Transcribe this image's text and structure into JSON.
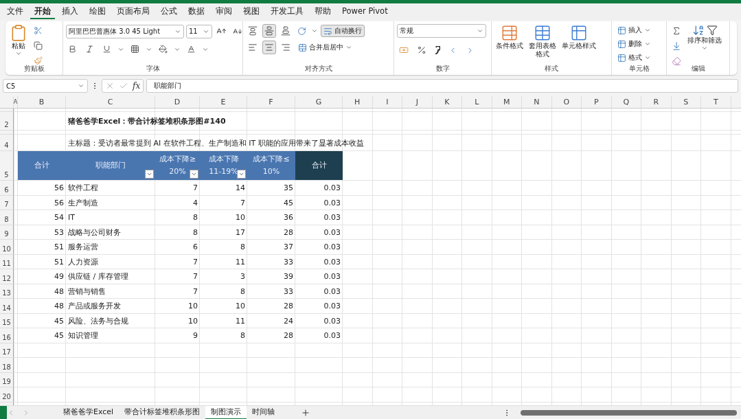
{
  "menu_tabs": [
    {
      "label": "文件",
      "selected": false
    },
    {
      "label": "开始",
      "selected": true
    },
    {
      "label": "插入",
      "selected": false
    },
    {
      "label": "绘图",
      "selected": false
    },
    {
      "label": "页面布局",
      "selected": false
    },
    {
      "label": "公式",
      "selected": false
    },
    {
      "label": "数据",
      "selected": false
    },
    {
      "label": "审阅",
      "selected": false
    },
    {
      "label": "视图",
      "selected": false
    },
    {
      "label": "开发工具",
      "selected": false
    },
    {
      "label": "帮助",
      "selected": false
    },
    {
      "label": "Power Pivot",
      "selected": false
    }
  ],
  "ribbon": {
    "clipboard": {
      "label": "剪贴板",
      "paste": "粘贴"
    },
    "font": {
      "label": "字体",
      "font_name": "阿里巴巴普惠体 3.0 45 Light",
      "font_size": "11"
    },
    "alignment": {
      "label": "对齐方式",
      "align_buttons": [
        {
          "kind": "top",
          "selected": false
        },
        {
          "kind": "middle",
          "selected": true
        },
        {
          "kind": "bottom",
          "selected": false
        },
        {
          "kind": "left",
          "selected": false
        },
        {
          "kind": "center",
          "selected": true
        },
        {
          "kind": "right",
          "selected": false
        }
      ],
      "wrap_text": {
        "label": "自动换行",
        "selected": true
      },
      "merge": "合并后居中"
    },
    "number": {
      "label": "数字",
      "format": "常规"
    },
    "styles": {
      "label": "样式",
      "buttons": [
        {
          "label": "条件格式",
          "kind": "conditional"
        },
        {
          "label": "套用表格格式",
          "kind": "table"
        },
        {
          "label": "单元格样式",
          "kind": "cell"
        }
      ]
    },
    "cells": {
      "label": "单元格",
      "buttons": [
        "插入",
        "删除",
        "格式"
      ]
    },
    "editing": {
      "label": "编辑",
      "sort_filter": "排序和筛选"
    }
  },
  "formula_bar": {
    "name_box": "C5",
    "function_symbol": "fx",
    "formula": "职能部门"
  },
  "columns": [
    "A",
    "B",
    "C",
    "D",
    "E",
    "F",
    "G",
    "H",
    "I",
    "J",
    "K",
    "L",
    "M",
    "N",
    "O",
    "P",
    "Q",
    "R",
    "S",
    "T"
  ],
  "sheet": {
    "title": "猪爸爸学Excel：带合计标签堆积条形图#140",
    "subtitle": "主标题：受访者最常提到 AI 在软件工程、生产制造和 IT 职能的应用带来了显著成本收益",
    "header": [
      "合计",
      "职能部门",
      "成本下降≥\n20%",
      "成本下降\n11-19%",
      "成本下降≤\n10%",
      "合计"
    ],
    "rows": [
      [
        "56",
        "软件工程",
        "7",
        "14",
        "35",
        "0.03"
      ],
      [
        "56",
        "生产制造",
        "4",
        "7",
        "45",
        "0.03"
      ],
      [
        "54",
        "IT",
        "8",
        "10",
        "36",
        "0.03"
      ],
      [
        "53",
        "战略与公司财务",
        "8",
        "17",
        "28",
        "0.03"
      ],
      [
        "51",
        "服务运营",
        "6",
        "8",
        "37",
        "0.03"
      ],
      [
        "51",
        "人力资源",
        "7",
        "11",
        "33",
        "0.03"
      ],
      [
        "49",
        "供应链 / 库存管理",
        "7",
        "3",
        "39",
        "0.03"
      ],
      [
        "48",
        "营销与销售",
        "7",
        "8",
        "33",
        "0.03"
      ],
      [
        "48",
        "产品或服务开发",
        "10",
        "10",
        "28",
        "0.03"
      ],
      [
        "45",
        "风险、法务与合规",
        "10",
        "11",
        "24",
        "0.03"
      ],
      [
        "45",
        "知识管理",
        "9",
        "8",
        "28",
        "0.03"
      ]
    ]
  },
  "row_numbers": [
    "2",
    "4",
    "5",
    "6",
    "7",
    "8",
    "9",
    "10",
    "11",
    "12",
    "13",
    "14",
    "15",
    "16",
    "17",
    "18",
    "19",
    "20"
  ],
  "sheet_tabs": [
    {
      "label": "猪爸爸学Excel",
      "selected": false
    },
    {
      "label": "带合计标签堆积条形图",
      "selected": false
    },
    {
      "label": "制图演示",
      "selected": true
    },
    {
      "label": "时间轴",
      "selected": false
    }
  ]
}
